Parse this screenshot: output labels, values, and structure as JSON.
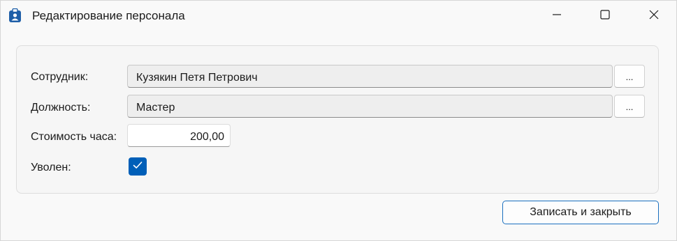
{
  "window": {
    "title": "Редактирование персонала",
    "icons": {
      "app": "employee-badge-icon",
      "minimize": "minimize-icon",
      "maximize": "maximize-icon",
      "close": "close-icon"
    },
    "accent_color": "#005fb8"
  },
  "form": {
    "employee": {
      "label": "Сотрудник:",
      "value": "Кузякин Петя Петрович",
      "select_label": "..."
    },
    "position": {
      "label": "Должность:",
      "value": "Мастер",
      "select_label": "..."
    },
    "hour_cost": {
      "label": "Стоимость часа:",
      "value": "200,00"
    },
    "dismissed": {
      "label": "Уволен:",
      "checked": true
    }
  },
  "footer": {
    "save_close_label": "Записать и закрыть"
  }
}
